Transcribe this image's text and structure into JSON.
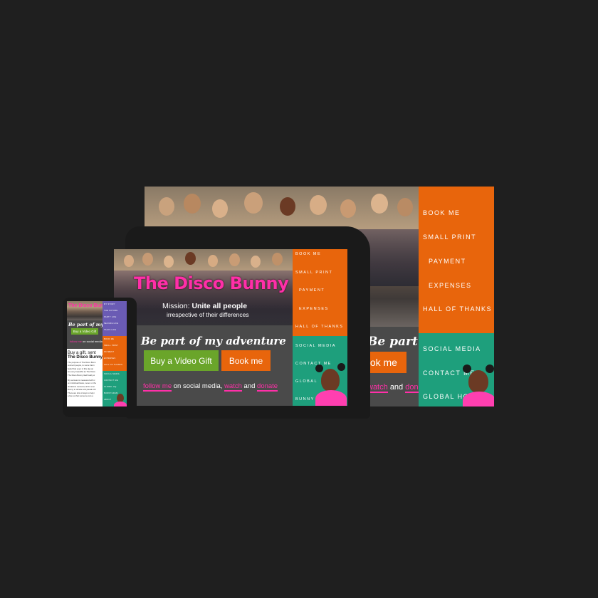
{
  "brand": {
    "name": "The Disco Bunny"
  },
  "hero": {
    "mission_prefix": "Mission:",
    "mission_main": "Unite all people",
    "mission_sub": "irrespective of their differences"
  },
  "cta": {
    "headline": "Be part of my adventure",
    "video_gift": "Buy a Video Gift",
    "book_me": "Book me",
    "book_me_partial": "ook me"
  },
  "follow": {
    "follow_me": "follow me",
    "text1": "on social media,",
    "watch": "watch",
    "and": "and",
    "donate": "donate"
  },
  "desktop_menu": {
    "orange": [
      "BOOK ME",
      "SMALL PRINT",
      "PAYMENT",
      "EXPENSES",
      "HALL OF THANKS"
    ],
    "green": [
      "SOCIAL MEDIA",
      "CONTACT ME",
      "GLOBAL HQ"
    ]
  },
  "tablet_menu": {
    "orange": [
      "BOOK ME",
      "SMALL PRINT",
      "PAYMENT",
      "EXPENSES",
      "HALL OF THANKS"
    ],
    "green": [
      "SOCIAL MEDIA",
      "CONTACT ME",
      "GLOBAL",
      "BUNNY"
    ]
  },
  "mobile_menu": {
    "purple": [
      "MY STORY",
      "THE FUTURE",
      "PARTY LIFE",
      "SECURE LIFE",
      "TALKS LIFE"
    ],
    "orange": [
      "BOOK ME",
      "SMALL PRINT",
      "PAYMENT",
      "EXPENSES",
      "HALL OF THANKS"
    ],
    "green": [
      "SOCIAL MEDIA",
      "CONTACT ME",
      "GLOBAL HQ",
      "BUNNYGRAM",
      "ABOUT"
    ]
  },
  "mobile": {
    "headline": "Be part of my a",
    "video_gift": "Buy a Video Gift",
    "follow_text": "on social media,",
    "article_title1": "Buy a gift, sent",
    "article_title2": "The Disco Bunny",
    "body_lines": [
      "The purpose of The Disco Bunn",
      "connect people, to some harm",
      "belief that even in this day an",
      "as every beautiful as The Disco",
      "The Disco Bunny itself really w",
      "",
      "My success is measured with c",
      "on individual basis, never on the",
      "donations received, all for ever",
      "Bunny to donate and pleade oth",
      "There are lots of ways to help i",
      "a few so that someone can a"
    ]
  },
  "colors": {
    "orange": "#e8650c",
    "green": "#1e9f7c",
    "purple": "#6a5bb4",
    "pink": "#ff2fa8",
    "gray": "#4a4a4a",
    "button_green": "#6aa52a"
  }
}
